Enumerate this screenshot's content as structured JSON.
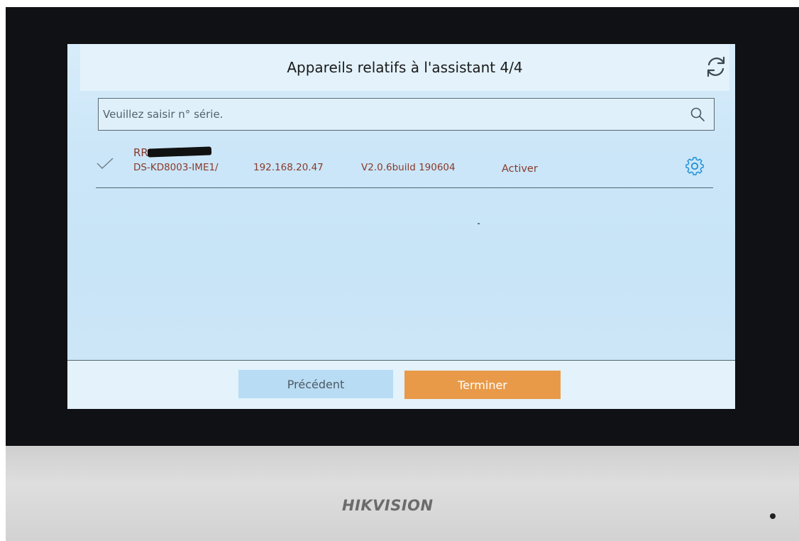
{
  "header": {
    "title": "Appareils relatifs à l'assistant 4/4",
    "refresh_icon": "refresh-icon"
  },
  "search": {
    "placeholder": "Veuillez saisir n° série.",
    "icon": "search-icon"
  },
  "devices": [
    {
      "selected": true,
      "name": "RR",
      "model": "DS-KD8003-IME1/",
      "ip": "192.168.20.47",
      "version": "V2.0.6build 190604",
      "status": "Activer",
      "settings_icon": "gear-icon"
    }
  ],
  "footer": {
    "previous_label": "Précédent",
    "finish_label": "Terminer"
  },
  "device_brand": "HIKVISION",
  "colors": {
    "screen_bg": "#cbe6f8",
    "panel_bg": "#e3f2fb",
    "text_accent": "#8a3a2b",
    "gear_blue": "#1f8fd6",
    "finish_orange": "#e99a48",
    "previous_blue": "#b8dcf4"
  }
}
